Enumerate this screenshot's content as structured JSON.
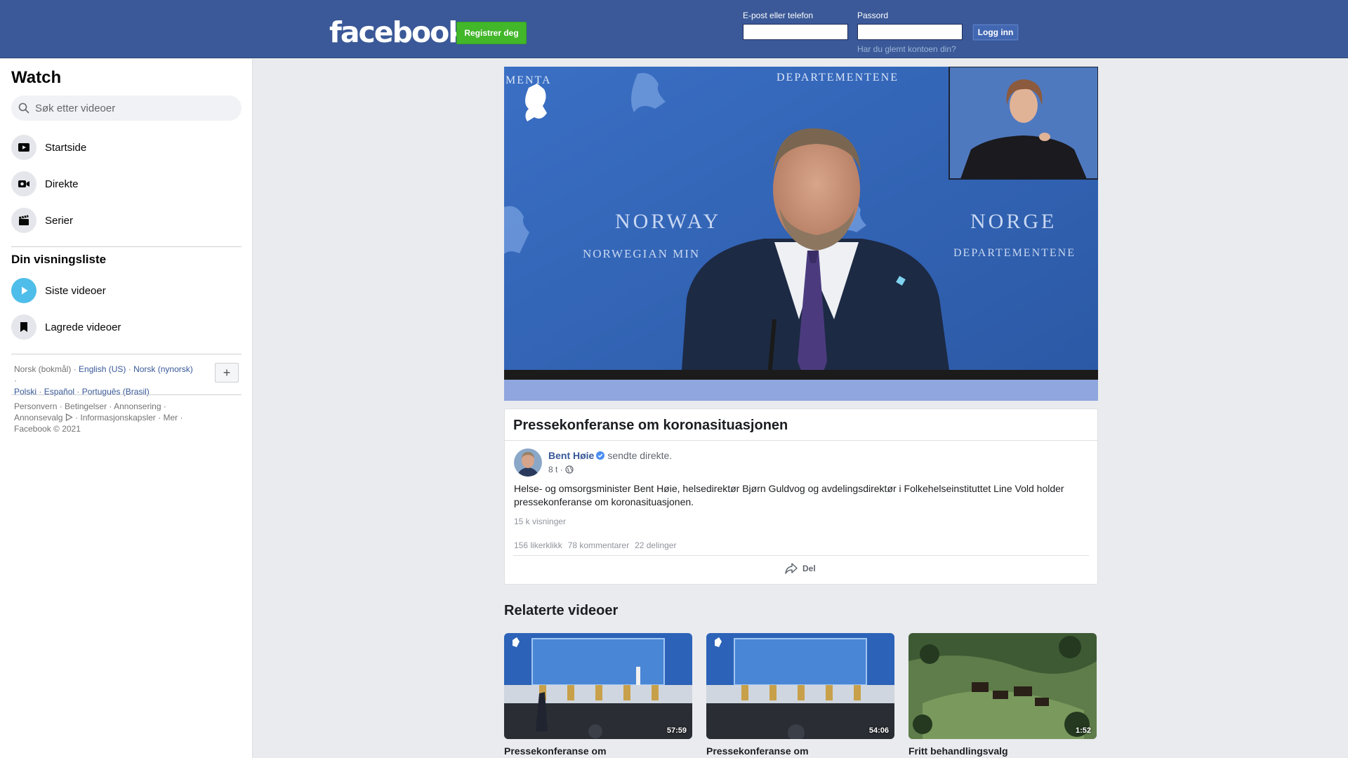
{
  "header": {
    "logo_text": "facebook",
    "register_label": "Registrer deg",
    "email_label": "E-post eller telefon",
    "email_value": "",
    "password_label": "Passord",
    "password_value": "",
    "login_label": "Logg inn",
    "forgot_label": "Har du glemt kontoen din?"
  },
  "sidebar": {
    "title": "Watch",
    "search_placeholder": "Søk etter videoer",
    "nav": [
      {
        "label": "Startside",
        "icon": "play-square-icon"
      },
      {
        "label": "Direkte",
        "icon": "live-camera-icon"
      },
      {
        "label": "Serier",
        "icon": "clapperboard-icon"
      }
    ],
    "list_title": "Din visningsliste",
    "list": [
      {
        "label": "Siste videoer",
        "icon": "play-circle-icon"
      },
      {
        "label": "Lagrede videoer",
        "icon": "bookmark-icon"
      }
    ],
    "languages": {
      "current": "Norsk (bokmål)",
      "others": [
        "English (US)",
        "Norsk (nynorsk)",
        "Polski",
        "Español",
        "Português (Brasil)"
      ],
      "add_label": "+"
    },
    "footer": {
      "links": [
        "Personvern",
        "Betingelser",
        "Annonsering",
        "Annonsevalg",
        "Informasjonskapsler",
        "Mer"
      ],
      "copyright": "Facebook © 2021"
    }
  },
  "video": {
    "backdrop_left_top": "MENTA",
    "backdrop_top_right": "DEPARTEMENTENE",
    "backdrop_norway": "NORWAY",
    "backdrop_norwegian": "NORWEGIAN MIN",
    "backdrop_norge": "NORGE",
    "backdrop_departementene": "DEPARTEMENTENE"
  },
  "post": {
    "title": "Pressekonferanse om koronasituasjonen",
    "author": "Bent Høie",
    "action": "sendte direkte.",
    "time": "8 t ·",
    "text": "Helse- og omsorgsminister Bent Høie, helsedirektør Bjørn Guldvog og avdelingsdirektør i Folkehelseinstituttet Line Vold holder pressekonferanse om koronasituasjonen.",
    "views": "15 k visninger",
    "likes": "156 likerklikk",
    "comments": "78 kommentarer",
    "shares": "22 delinger",
    "share_label": "Del"
  },
  "related": {
    "title": "Relaterte videoer",
    "items": [
      {
        "title": "Pressekonferanse om",
        "duration": "57:59"
      },
      {
        "title": "Pressekonferanse om",
        "duration": "54:06"
      },
      {
        "title": "Fritt behandlingsvalg",
        "duration": "1:52"
      }
    ]
  },
  "colors": {
    "topbar": "#3b5998",
    "register_green": "#42b72a",
    "link_blue": "#385898",
    "page_bg": "#e9ebee"
  }
}
